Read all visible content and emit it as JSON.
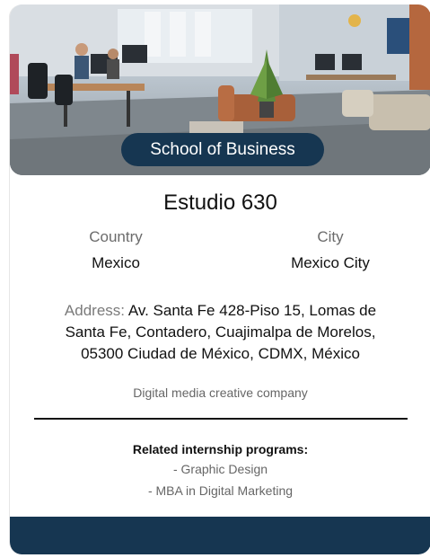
{
  "card": {
    "badge": "School of Business",
    "name": "Estudio 630",
    "country_label": "Country",
    "country_value": "Mexico",
    "city_label": "City",
    "city_value": "Mexico City",
    "address_label": "Address:",
    "address_value": "Av. Santa Fe 428-Piso 15, Lomas de Santa Fe, Contadero, Cuajimalpa de Morelos, 05300 Ciudad de México, CDMX, México",
    "description": "Digital media creative company",
    "related_title": "Related internship programs:",
    "related_programs": [
      "- Graphic Design",
      "- MBA in Digital Marketing"
    ]
  },
  "colors": {
    "navy": "#163651",
    "text": "#111111",
    "muted": "#6b6b6b"
  }
}
